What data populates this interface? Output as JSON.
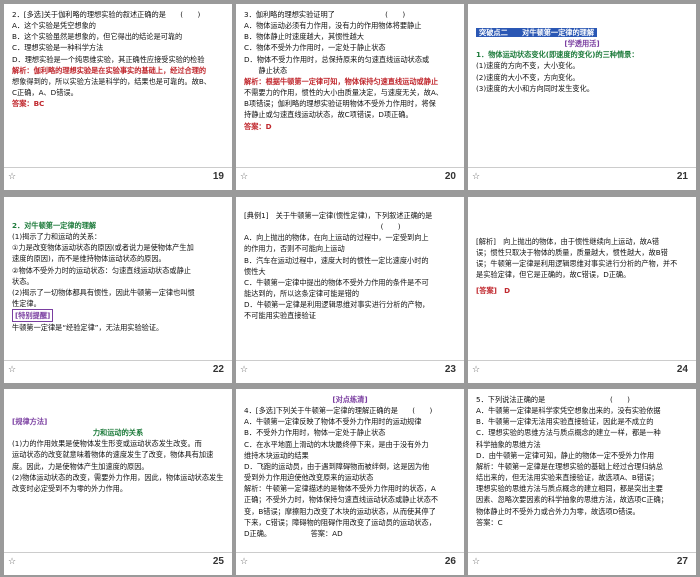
{
  "slides": [
    {
      "page": "19",
      "lines": [
        "2．[多选]关于伽利略的理想实验的叙述正确的是　　(　　)",
        "A．这个实验是凭空想象的",
        "B．这个实验虽然是想象的，但它得出的结论是可靠的",
        "C．理想实验是一种科学方法",
        "D．理想实验是一个纯思维实验，其正确性应接受实验的检验",
        "解析：伽利略的理想实验是在实验事实的基础上，经过合理的",
        "想象得到的，所以实验方法是科学的，结果也是可靠的。故B、",
        "C正确，A、D错误。",
        "答案：BC"
      ]
    },
    {
      "page": "20",
      "lines": [
        "3．伽利略的理想实验证明了　　　　　　　(　　)",
        "A．物体运动必须有力作用，没有力的作用物体将要静止",
        "B．物体静止时速度越大，其惯性越大",
        "C．物体不受外力作用时，一定处于静止状态",
        "D．物体不受力作用时，总保持原来的匀速直线运动状态或",
        "　　静止状态",
        "解析：根据牛顿第一定律可知，物体保持匀速直线运动或静止",
        "不需要力的作用，惯性的大小由质量决定，与速度无关，故A、",
        "B项错误；伽利略的理想实验证明物体不受外力作用时，将保",
        "持静止或匀速直线运动状态，故C项错误，D项正确。",
        "答案：D"
      ]
    },
    {
      "page": "21",
      "lines": [
        "突破点二　　对牛顿第一定律的理解",
        "[学透用活]",
        "1．物体运动状态变化(即速度的变化)的三种情景：",
        "(1)速度的方向不变，大小变化。",
        "(2)速度的大小不变，方向变化。",
        "(3)速度的大小和方向同时发生变化。"
      ]
    },
    {
      "page": "22",
      "lines": [
        "2．对牛顿第一定律的理解",
        "(1)揭示了力和运动的关系：",
        "①力是改变物体运动状态的原因(或者说力是使物体产生加",
        "速度的原因)，而不是维持物体运动状态的原因。",
        "②物体不受外力时的运动状态：匀速直线运动状态或静止",
        "状态。",
        "(2)揭示了一切物体都具有惯性，因此牛顿第一定律也叫惯",
        "性定律。",
        "[特别提醒]",
        "牛顿第一定律是“经验定律”，无法用实验验证。"
      ]
    },
    {
      "page": "23",
      "lines": [
        "[典例1]　关于牛顿第一定律(惯性定律)，下列叙述正确的是",
        "　　　　　　　　　　　　　　　　　　　(　　)",
        "A．向上抛出的物体，在向上运动的过程中，一定受到向上",
        "的作用力，否则不可能向上运动",
        "B．汽车在运动过程中，速度大时的惯性一定比速度小时的",
        "惯性大",
        "C．牛顿第一定律中提出的物体不受外力作用的条件是不可",
        "能达到的，所以这条定律可能是错的",
        "D．牛顿第一定律是利用逻辑思维对事实进行分析的产物，",
        "不可能用实验直接验证"
      ]
    },
    {
      "page": "24",
      "lines": [
        "[解析]　向上抛出的物体，由于惯性继续向上运动，故A错",
        "误；惯性只取决于物体的质量，质量越大，惯性越大，故B错",
        "误；牛顿第一定律是利用逻辑思维对事实进行分析的产物，并不",
        "是实验定律，但它是正确的，故C错误，D正确。",
        "[答案]　D"
      ]
    },
    {
      "page": "25",
      "lines": [
        "[规律方法]",
        "力和运动的关系",
        "(1)力的作用效果是使物体发生形变或运动状态发生改变。而",
        "运动状态的改变就意味着物体的速度发生了改变，物体具有加速",
        "度。因此，力是使物体产生加速度的原因。",
        "(2)物体运动状态的改变，需要外力作用，因此，物体运动状态发生",
        "改变时必定受到不为零的外力作用。"
      ]
    },
    {
      "page": "26",
      "lines": [
        "[对点练清]",
        "4．[多选]下列关于牛顿第一定律的理解正确的是　　(　　)",
        "A．牛顿第一定律反映了物体不受外力作用时的运动规律",
        "B．不受外力作用时，物体一定处于静止状态",
        "C．在水平地面上滑动的木块最终停下来，是由于没有外力",
        "维持木块运动的结果",
        "D．飞跑的运动员，由于遇到障碍物而被绊倒，这是因为他",
        "受到外力作用迫使他改变原来的运动状态",
        "解析：牛顿第一定律描述的是物体不受外力作用时的状态，A",
        "正确；不受外力时，物体保持匀速直线运动状态或静止状态不",
        "变，B错误；摩擦阻力改变了木块的运动状态，从而使其停了",
        "下来，C错误；障碍物的阻碍作用改变了运动员的运动状态，",
        "D正确。　　　　　　答案：AD"
      ]
    },
    {
      "page": "27",
      "lines": [
        "5．下列说法正确的是　　　　　　　　　(　　)",
        "A．牛顿第一定律是科学家凭空想象出来的，没有实验依据",
        "B．牛顿第一定律无法用实验直接验证，因此是不成立的",
        "C．理想实验的思维方法与质点概念的建立一样，都是一种",
        "科学抽象的思维方法",
        "D．由牛顿第一定律可知，静止的物体一定不受外力作用",
        "解析：牛顿第一定律是在理想实验的基础上经过合理归纳总",
        "结出来的，但无法用实验来直接验证，故选项A、B错误；",
        "理想实验的思维方法与质点概念的建立相同，都是突出主要",
        "因素、忽略次要因素的科学抽象的思维方法，故选项C正确；",
        "物体静止时不受外力或合外力为零，故选项D错误。",
        "答案：C"
      ]
    }
  ]
}
